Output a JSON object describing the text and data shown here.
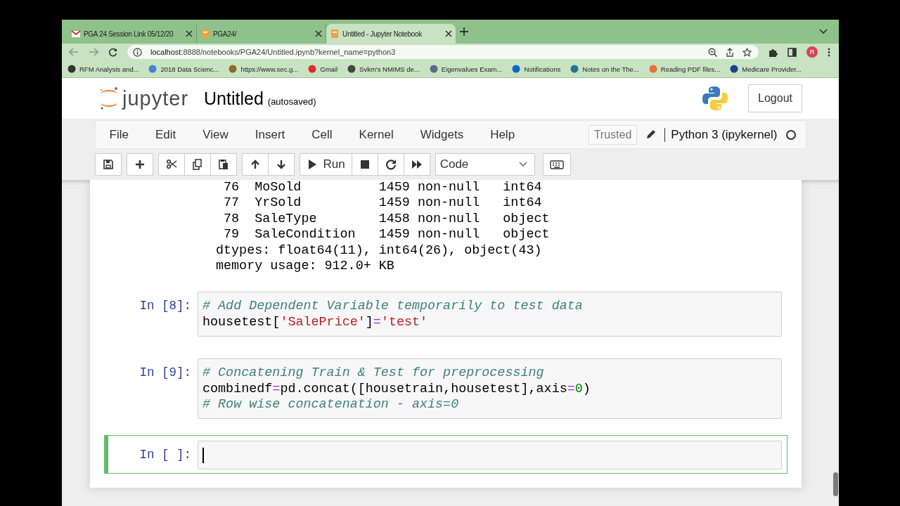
{
  "browser": {
    "tabs": [
      {
        "title": "PGA 24 Session Link 05/12/20",
        "kind": "mail",
        "selected": false
      },
      {
        "title": "PGA24/",
        "kind": "notebook",
        "selected": false
      },
      {
        "title": "Untitled - Jupyter Notebook",
        "kind": "notebook",
        "selected": true
      }
    ],
    "url_host": "localhost",
    "url_rest": ":8888/notebooks/PGA24/Untitled.ipynb?kernel_name=python3",
    "profile_initial": "R",
    "bookmarks": [
      {
        "title": "RFM Analysis and...",
        "color": "#333333"
      },
      {
        "title": "2018 Data Scienc...",
        "color": "#4a7fd4"
      },
      {
        "title": "https://www.sec.g...",
        "color": "#8a6a2a"
      },
      {
        "title": "Gmail",
        "color": "#d93025"
      },
      {
        "title": "Svkm's NMIMS de...",
        "color": "#444444"
      },
      {
        "title": "Eigenvalues Exam...",
        "color": "#5a6a8a"
      },
      {
        "title": "Notifications",
        "color": "#0a66c2"
      },
      {
        "title": "Notes on the The...",
        "color": "#21759b"
      },
      {
        "title": "Reading PDF files...",
        "color": "#e8703a"
      },
      {
        "title": "Medicare Provider...",
        "color": "#1f3f8f"
      }
    ]
  },
  "notebook": {
    "logo_text": "jupyter",
    "title": "Untitled",
    "save_status": "(autosaved)",
    "logout": "Logout",
    "menu": [
      "File",
      "Edit",
      "View",
      "Insert",
      "Cell",
      "Kernel",
      "Widgets",
      "Help"
    ],
    "trusted": "Trusted",
    "kernel_name": "Python 3 (ipykernel)",
    "kernel_busy": false,
    "toolbar": [
      {
        "kind": "group",
        "buttons": [
          {
            "kind": "save"
          }
        ]
      },
      {
        "kind": "group",
        "buttons": [
          {
            "kind": "plus"
          }
        ]
      },
      {
        "kind": "group",
        "buttons": [
          {
            "kind": "cut"
          },
          {
            "kind": "copy"
          },
          {
            "kind": "paste"
          }
        ]
      },
      {
        "kind": "group",
        "buttons": [
          {
            "kind": "up"
          },
          {
            "kind": "down"
          }
        ]
      },
      {
        "kind": "group",
        "buttons": [
          {
            "kind": "run",
            "label": "Run"
          },
          {
            "kind": "stop"
          },
          {
            "kind": "restart"
          },
          {
            "kind": "forward"
          }
        ]
      },
      {
        "kind": "select",
        "value": "Code"
      },
      {
        "kind": "group",
        "buttons": [
          {
            "kind": "keyboard"
          }
        ]
      }
    ],
    "cells": [
      {
        "kind": "output",
        "lines": [
          " 76  MoSold          1459 non-null   int64",
          " 77  YrSold          1459 non-null   int64",
          " 78  SaleType        1458 non-null   object",
          " 79  SaleCondition   1459 non-null   object",
          "dtypes: float64(11), int64(26), object(43)",
          "memory usage: 912.0+ KB"
        ]
      },
      {
        "kind": "code",
        "prompt": "In [8]:",
        "selected": false,
        "lines": [
          [
            {
              "t": "# Add Dependent Variable temporarily to test data",
              "kind": "comment"
            }
          ],
          [
            {
              "t": "housetest[",
              "kind": "name"
            },
            {
              "t": "'SalePrice'",
              "kind": "string"
            },
            {
              "t": "]",
              "kind": "name"
            },
            {
              "t": "=",
              "kind": "operator"
            },
            {
              "t": "'test'",
              "kind": "string"
            }
          ]
        ]
      },
      {
        "kind": "code",
        "prompt": "In [9]:",
        "selected": false,
        "lines": [
          [
            {
              "t": "# Concatening Train & Test for preprocessing",
              "kind": "comment"
            }
          ],
          [
            {
              "t": "combinedf",
              "kind": "name"
            },
            {
              "t": "=",
              "kind": "operator"
            },
            {
              "t": "pd.concat([housetrain,housetest],axis",
              "kind": "name"
            },
            {
              "t": "=",
              "kind": "operator"
            },
            {
              "t": "0",
              "kind": "number"
            },
            {
              "t": ")",
              "kind": "name"
            }
          ],
          [
            {
              "t": "# Row wise concatenation - axis=0",
              "kind": "comment"
            }
          ]
        ]
      },
      {
        "kind": "code",
        "prompt": "In [ ]:",
        "selected": true
      }
    ]
  }
}
